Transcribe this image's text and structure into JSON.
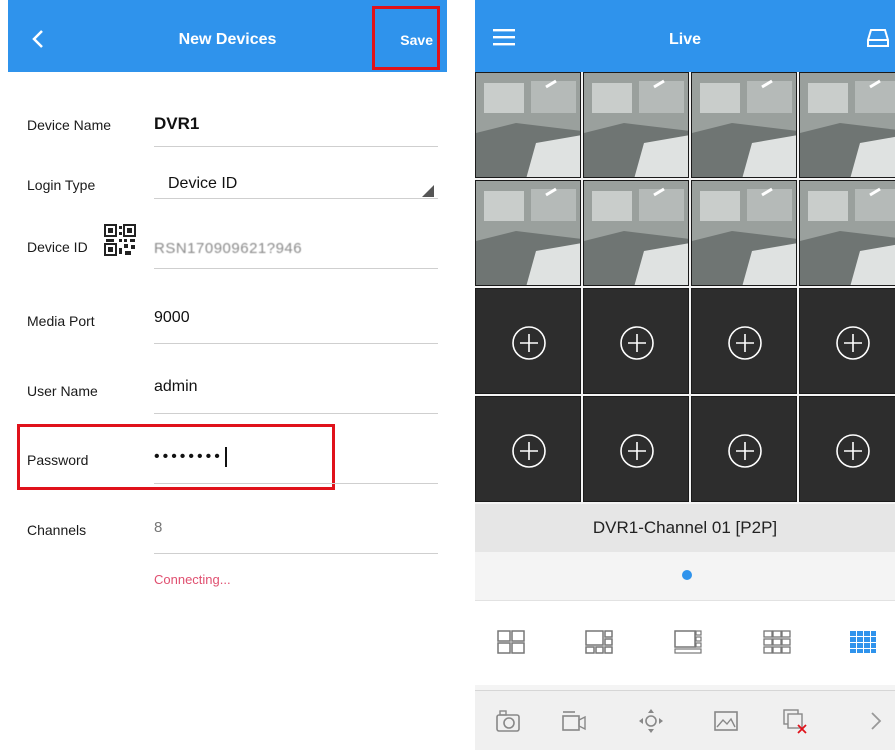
{
  "left": {
    "header": {
      "title": "New Devices",
      "save_label": "Save"
    },
    "form": {
      "device_name": {
        "label": "Device Name",
        "value": "DVR1"
      },
      "login_type": {
        "label": "Login Type",
        "value": "Device ID"
      },
      "device_id": {
        "label": "Device ID",
        "value": "RSN170909621?946"
      },
      "media_port": {
        "label": "Media Port",
        "value": "9000"
      },
      "user_name": {
        "label": "User Name",
        "value": "admin"
      },
      "password": {
        "label": "Password",
        "value": "••••••••"
      },
      "channels": {
        "label": "Channels",
        "value": "8"
      }
    },
    "status": "Connecting..."
  },
  "right": {
    "header": {
      "title": "Live"
    },
    "grid": {
      "columns": 4,
      "rows": 4,
      "camera_cells": 8
    },
    "channel_label": "DVR1-Channel 01 [P2P]",
    "layout_options": [
      "layout-4",
      "layout-6",
      "layout-8",
      "layout-9",
      "layout-16"
    ],
    "selected_layout": "layout-16",
    "tools": [
      "snapshot",
      "record",
      "ptz",
      "image",
      "close-all",
      "more"
    ]
  },
  "colors": {
    "accent": "#2f93ec",
    "highlight": "#e0121b",
    "status": "#e05070"
  }
}
